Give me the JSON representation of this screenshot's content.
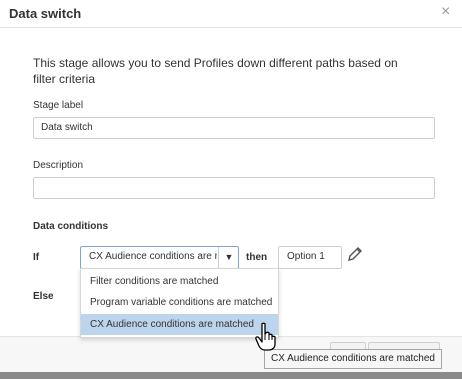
{
  "dialog": {
    "title": "Data switch",
    "close_glyph": "×",
    "intro": "This stage allows you to send Profiles down different paths based on filter criteria"
  },
  "stage_label": {
    "label": "Stage label",
    "value": "Data switch"
  },
  "description": {
    "label": "Description",
    "value": ""
  },
  "data_conditions": {
    "heading": "Data conditions",
    "if_label": "If",
    "selected_value": "CX Audience conditions are matched",
    "dropdown_arrow": "▼",
    "then_label": "then",
    "option_value": "Option 1",
    "else_label": "Else",
    "options": [
      "Filter conditions are matched",
      "Program variable conditions are matched",
      "CX Audience conditions are matched"
    ],
    "selected_index": 2
  },
  "footer": {
    "partial_button_label": "e"
  },
  "tooltip": {
    "text": "CX Audience conditions are matched"
  },
  "icons": {
    "pencil": "pencil-icon",
    "close": "close-icon",
    "cursor": "hand-pointer-icon"
  },
  "colors": {
    "selected_option_bg": "#bcd4ec",
    "select_border_focus": "#7aa7d8",
    "backdrop": "#6f6f6f"
  }
}
